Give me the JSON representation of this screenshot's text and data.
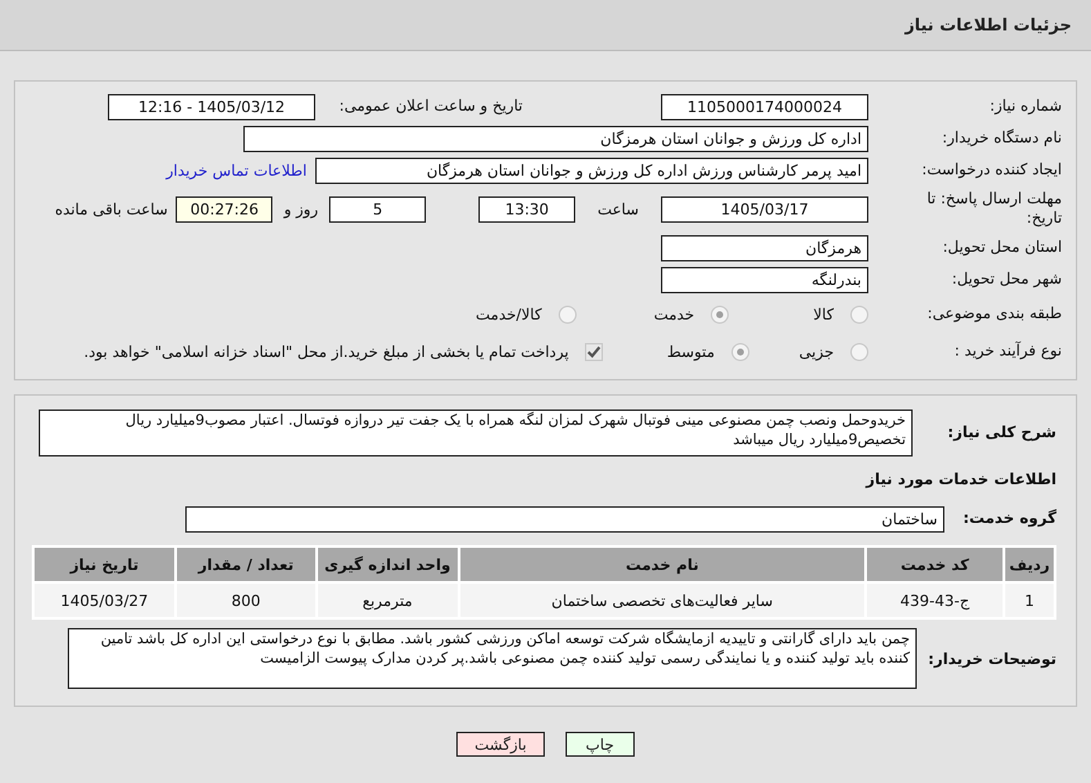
{
  "header": {
    "title": "جزئیات اطلاعات نیاز"
  },
  "details": {
    "need_number": {
      "label": "شماره نیاز:",
      "value": "1105000174000024"
    },
    "announce": {
      "label": "تاریخ و ساعت اعلان عمومی:",
      "value": "1405/03/12 - 12:16"
    },
    "buyer_org": {
      "label": "نام دستگاه خریدار:",
      "value": "اداره کل ورزش و جوانان استان هرمزگان"
    },
    "requester": {
      "label": "ایجاد کننده درخواست:",
      "value": "امید پرمر کارشناس ورزش اداره کل ورزش و جوانان استان هرمزگان",
      "link": "اطلاعات تماس خریدار"
    },
    "deadline": {
      "label": "مهلت ارسال پاسخ: تا تاریخ:",
      "date": "1405/03/17",
      "time_label": "ساعت",
      "time": "13:30",
      "days": "5",
      "days_label": "روز و",
      "remaining": "00:27:26",
      "remaining_label": "ساعت باقی مانده"
    },
    "province": {
      "label": "استان محل تحویل:",
      "value": "هرمزگان"
    },
    "city": {
      "label": "شهر محل تحویل:",
      "value": "بندرلنگه"
    },
    "category": {
      "label": "طبقه بندی موضوعی:",
      "options": [
        {
          "label": "کالا",
          "selected": false
        },
        {
          "label": "خدمت",
          "selected": true
        },
        {
          "label": "کالا/خدمت",
          "selected": false
        }
      ]
    },
    "process": {
      "label": "نوع فرآیند خرید :",
      "options": [
        {
          "label": "جزیی",
          "selected": false
        },
        {
          "label": "متوسط",
          "selected": true
        }
      ],
      "payment": {
        "checked": true,
        "text": "پرداخت تمام یا بخشی از مبلغ خرید.از محل \"اسناد خزانه اسلامی\" خواهد بود."
      }
    }
  },
  "needs": {
    "description": {
      "label": "شرح کلی نیاز:",
      "value": "خریدوحمل ونصب چمن مصنوعی مینی فوتبال شهرک لمزان لنگه همراه با یک جفت تیر دروازه فوتسال. اعتبار مصوب9میلیارد ریال تخصیص9میلیارد ریال میباشد"
    },
    "services_title": "اطلاعات خدمات مورد نیاز",
    "service_group": {
      "label": "گروه خدمت:",
      "value": "ساختمان"
    },
    "table": {
      "columns": [
        "ردیف",
        "کد خدمت",
        "نام خدمت",
        "واحد اندازه گیری",
        "تعداد / مقدار",
        "تاریخ نیاز"
      ],
      "rows": [
        [
          "1",
          "ج-43-439",
          "سایر فعالیت‌های تخصصی ساختمان",
          "مترمربع",
          "800",
          "1405/03/27"
        ]
      ]
    },
    "buyer_notes": {
      "label": "توضیحات خریدار:",
      "value": "چمن باید دارای گارانتی و تاییدیه ازمایشگاه شرکت توسعه اماکن ورزشی کشور باشد. مطابق با نوع درخواستی این اداره کل باشد تامین کننده باید تولید کننده و یا نمایندگی رسمی تولید کننده چمن مصنوعی باشد.پر کردن مدارک پیوست الزامیست"
    }
  },
  "buttons": [
    {
      "kind": "print",
      "label": "چاپ"
    },
    {
      "kind": "back",
      "label": "بازگشت"
    }
  ]
}
